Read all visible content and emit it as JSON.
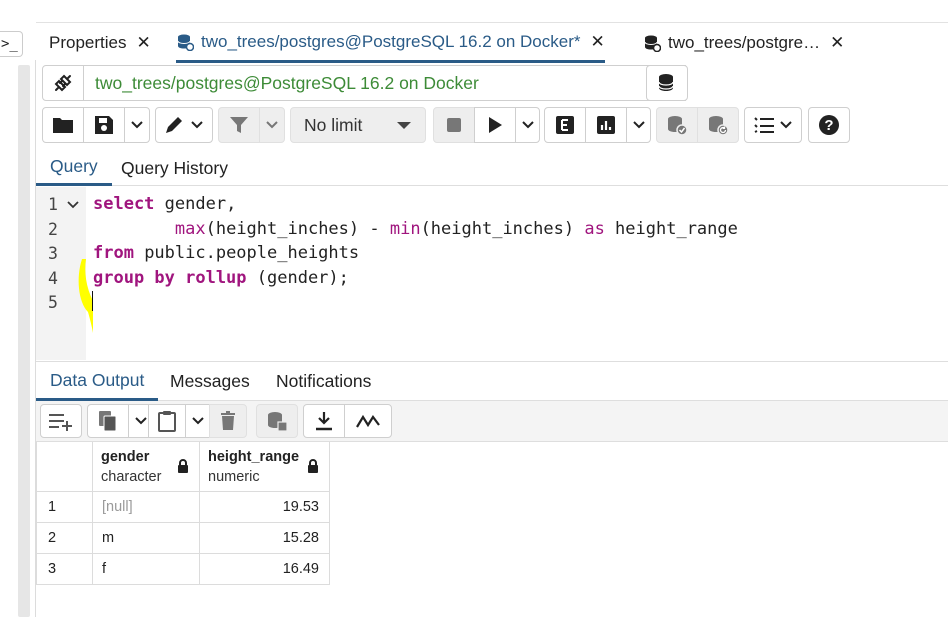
{
  "left_panel": {
    "button_label": ">_"
  },
  "tabs": [
    {
      "label": "Properties",
      "close": "✕"
    },
    {
      "label": "two_trees/postgres@PostgreSQL 16.2 on Docker*",
      "close": "✕"
    },
    {
      "label": "two_trees/postgre…",
      "close": "✕"
    }
  ],
  "connection": {
    "label": "two_trees/postgres@PostgreSQL 16.2 on Docker",
    "chevron": "⌄"
  },
  "toolbar": {
    "limit_label": "No limit",
    "icons": [
      "open-folder-icon",
      "save-icon",
      "pen-icon",
      "filter-icon",
      "stop-icon",
      "execute-icon",
      "explain-icon",
      "explain-analyze-icon",
      "commit-icon",
      "rollback-icon",
      "macros-icon",
      "help-icon"
    ]
  },
  "query_tabs": [
    "Query",
    "Query History"
  ],
  "editor": {
    "line_numbers": [
      "1",
      "2",
      "3",
      "4",
      "5"
    ],
    "lines": [
      [
        [
          "kw",
          "select"
        ],
        [
          "t",
          " gender,"
        ]
      ],
      [
        [
          "t",
          "        "
        ],
        [
          "fn",
          "max"
        ],
        [
          "t",
          "(height_inches) - "
        ],
        [
          "fn",
          "min"
        ],
        [
          "t",
          "(height_inches) "
        ],
        [
          "fn",
          "as"
        ],
        [
          "t",
          " height_range"
        ]
      ],
      [
        [
          "kw",
          "from"
        ],
        [
          "t",
          " public.people_heights"
        ]
      ],
      [
        [
          "kw",
          "group by rollup"
        ],
        [
          "t",
          " (gender);"
        ]
      ],
      []
    ]
  },
  "output_tabs": [
    "Data Output",
    "Messages",
    "Notifications"
  ],
  "grid": {
    "columns": [
      {
        "name": "gender",
        "type": "character"
      },
      {
        "name": "height_range",
        "type": "numeric"
      }
    ],
    "rows": [
      {
        "n": "1",
        "gender": "[null]",
        "height_range": "19.53"
      },
      {
        "n": "2",
        "gender": "m",
        "height_range": "15.28"
      },
      {
        "n": "3",
        "gender": "f",
        "height_range": "16.49"
      }
    ]
  },
  "colors": {
    "accent": "#2a5b87",
    "connection_green": "#3d8b37",
    "keyword": "#a0157e",
    "highlight": "#ffff00"
  }
}
